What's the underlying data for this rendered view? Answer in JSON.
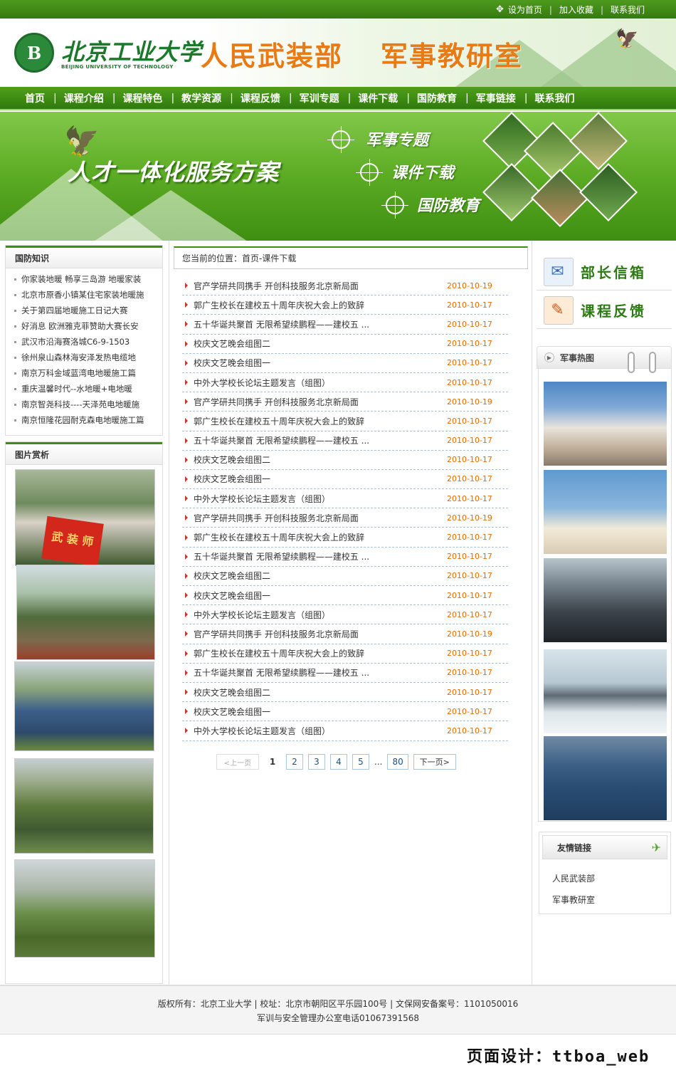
{
  "topbar": {
    "set_home": "设为首页",
    "add_fav": "加入收藏",
    "contact": "联系我们",
    "sep": "|"
  },
  "header": {
    "school_cn": "北京工业大学",
    "school_en": "BEIJING UNIVERSITY OF TECHNOLOGY",
    "logo_mark": "B",
    "title_left": "人民武装部",
    "title_right": "军事教研室"
  },
  "nav": {
    "items": [
      "首页",
      "课程介绍",
      "课程特色",
      "教学资源",
      "课程反馈",
      "军训专题",
      "课件下载",
      "国防教育",
      "军事链接",
      "联系我们"
    ]
  },
  "banner": {
    "slogan": "人才一体化服务方案",
    "items": [
      "军事专题",
      "课件下载",
      "国防教育"
    ]
  },
  "left": {
    "knowledge_title": "国防知识",
    "knowledge_items": [
      "你家装地暖 畅享三岛游 地暖家装",
      "北京市原香小镇某住宅家装地暖施",
      "关于第四届地暖施工日记大赛",
      "好消息 欧洲雅克菲赞助大赛长安",
      "武汉市沿海赛洛城C6-9-1503",
      "徐州泉山森林海安泽发热电缆地",
      "南京万科金域蓝湾电地暖施工篇",
      "重庆温馨时代--水地暖+电地暖",
      "南京智尧科技----天泽苑电地暖施",
      "南京恒隆花园耐克森电地暖施工篇"
    ],
    "gallery_title": "图片赏析",
    "banner_pic_text": "武 装 师"
  },
  "center": {
    "breadcrumb": "您当前的位置：首页-课件下载",
    "rows": [
      {
        "title": "官产学研共同携手 开创科技服务北京新局面",
        "date": "2010-10-19"
      },
      {
        "title": "郭广生校长在建校五十周年庆祝大会上的致辞",
        "date": "2010-10-17"
      },
      {
        "title": "五十华诞共聚首 无限希望续鹏程——建校五 ...",
        "date": "2010-10-17"
      },
      {
        "title": "校庆文艺晚会组图二",
        "date": "2010-10-17"
      },
      {
        "title": "校庆文艺晚会组图一",
        "date": "2010-10-17"
      },
      {
        "title": "中外大学校长论坛主题发言（组图）",
        "date": "2010-10-17"
      },
      {
        "title": "官产学研共同携手 开创科技服务北京新局面",
        "date": "2010-10-19"
      },
      {
        "title": "郭广生校长在建校五十周年庆祝大会上的致辞",
        "date": "2010-10-17"
      },
      {
        "title": "五十华诞共聚首 无限希望续鹏程——建校五 ...",
        "date": "2010-10-17"
      },
      {
        "title": "校庆文艺晚会组图二",
        "date": "2010-10-17"
      },
      {
        "title": "校庆文艺晚会组图一",
        "date": "2010-10-17"
      },
      {
        "title": "中外大学校长论坛主题发言（组图）",
        "date": "2010-10-17"
      },
      {
        "title": "官产学研共同携手 开创科技服务北京新局面",
        "date": "2010-10-19"
      },
      {
        "title": "郭广生校长在建校五十周年庆祝大会上的致辞",
        "date": "2010-10-17"
      },
      {
        "title": "五十华诞共聚首 无限希望续鹏程——建校五 ...",
        "date": "2010-10-17"
      },
      {
        "title": "校庆文艺晚会组图二",
        "date": "2010-10-17"
      },
      {
        "title": "校庆文艺晚会组图一",
        "date": "2010-10-17"
      },
      {
        "title": "中外大学校长论坛主题发言（组图）",
        "date": "2010-10-17"
      },
      {
        "title": "官产学研共同携手 开创科技服务北京新局面",
        "date": "2010-10-19"
      },
      {
        "title": "郭广生校长在建校五十周年庆祝大会上的致辞",
        "date": "2010-10-17"
      },
      {
        "title": "五十华诞共聚首 无限希望续鹏程——建校五 ...",
        "date": "2010-10-17"
      },
      {
        "title": "校庆文艺晚会组图二",
        "date": "2010-10-17"
      },
      {
        "title": "校庆文艺晚会组图一",
        "date": "2010-10-17"
      },
      {
        "title": "中外大学校长论坛主题发言（组图）",
        "date": "2010-10-17"
      }
    ],
    "pager": {
      "prev": "<上一页",
      "current": "1",
      "pages": [
        "2",
        "3",
        "4",
        "5"
      ],
      "ellipsis": "...",
      "last": "80",
      "next": "下一页>"
    }
  },
  "right": {
    "mailbox": "部长信箱",
    "feedback": "课程反馈",
    "hot_title": "军事热图",
    "friend_title": "友情链接",
    "friend_links": [
      "人民武装部",
      "军事教研室"
    ]
  },
  "footer": {
    "line1": "版权所有：北京工业大学 | 校址：北京市朝阳区平乐园100号 | 文保网安备案号：1101050016",
    "line2": "军训与安全管理办公室电话01067391568"
  },
  "design_credit": "页面设计：ttboa_web",
  "colors": {
    "brand_green": "#3d8f10",
    "date_orange": "#e56b00",
    "title_orange": "#e77b16"
  }
}
